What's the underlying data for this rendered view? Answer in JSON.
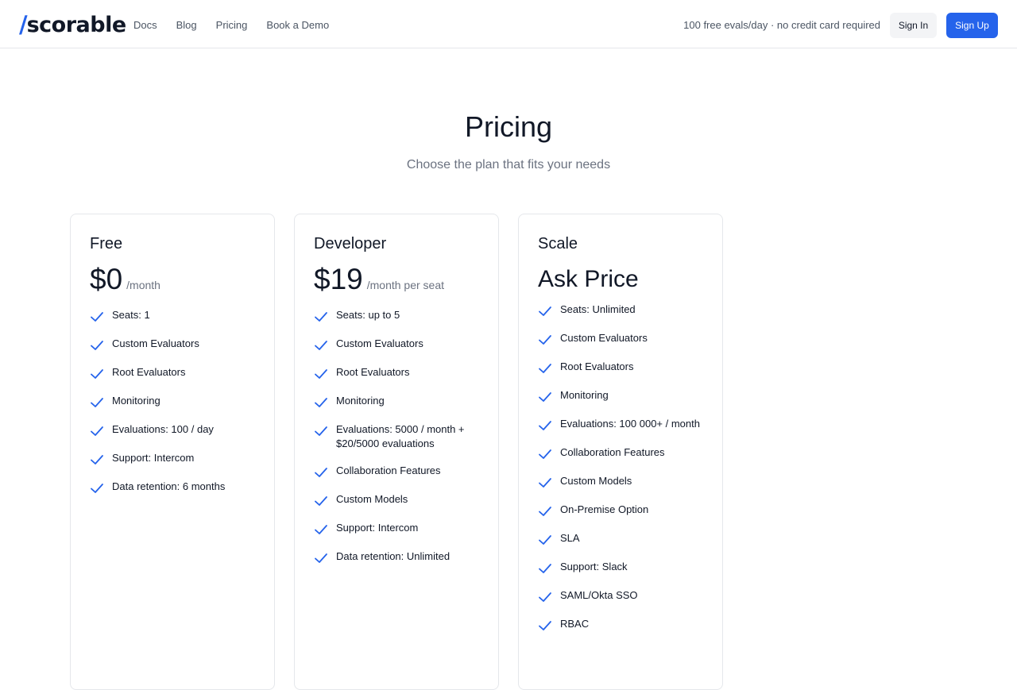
{
  "header": {
    "logo_slash": "/",
    "logo_text": "scorable",
    "nav": [
      "Docs",
      "Blog",
      "Pricing",
      "Book a Demo"
    ],
    "promo": "100 free evals/day · no credit card required",
    "signin_label": "Sign In",
    "signup_label": "Sign Up"
  },
  "title": "Pricing",
  "subtitle": "Choose the plan that fits your needs",
  "accent_color": "#2563eb",
  "plans": [
    {
      "name": "Free",
      "price": "$0",
      "per": "/month",
      "features": [
        "Seats: 1",
        "Custom Evaluators",
        "Root Evaluators",
        "Monitoring",
        "Evaluations: 100 / day",
        "Support: Intercom",
        "Data retention: 6 months"
      ]
    },
    {
      "name": "Developer",
      "price": "$19",
      "per": "/month per seat",
      "features": [
        "Seats: up to 5",
        "Custom Evaluators",
        "Root Evaluators",
        "Monitoring",
        "Evaluations: 5000 / month + $20/5000 evaluations",
        "Collaboration Features",
        "Custom Models",
        "Support: Intercom",
        "Data retention: Unlimited"
      ]
    },
    {
      "name": "Scale",
      "price": "Ask Price",
      "features": [
        "Seats: Unlimited",
        "Custom Evaluators",
        "Root Evaluators",
        "Monitoring",
        "Evaluations: 100 000+ / month",
        "Collaboration Features",
        "Custom Models",
        "On-Premise Option",
        "SLA",
        "Support: Slack",
        "SAML/Okta SSO",
        "RBAC"
      ]
    }
  ]
}
